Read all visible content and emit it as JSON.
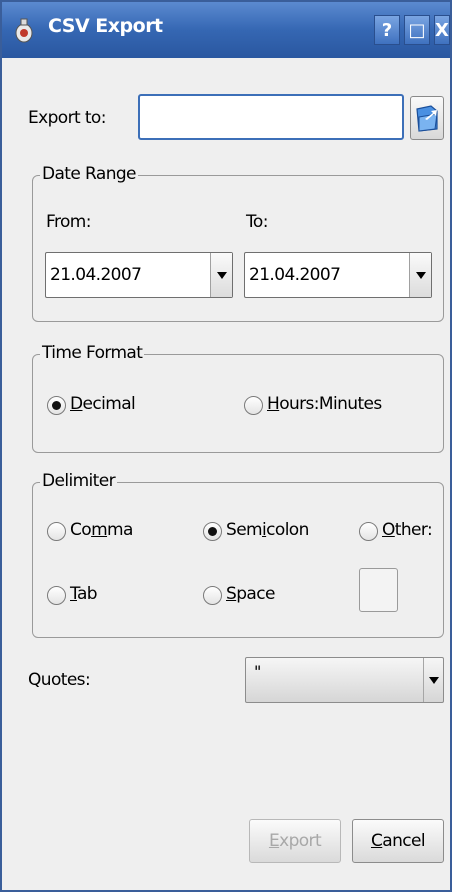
{
  "window": {
    "title": "CSV Export"
  },
  "titlebar": {
    "help": "?",
    "maximize": "□",
    "close": "X"
  },
  "export_to": {
    "label": "Export to:",
    "value": ""
  },
  "date_range": {
    "legend": "Date Range",
    "from_label": "From:",
    "to_label": "To:",
    "from_value": "21.04.2007",
    "to_value": "21.04.2007"
  },
  "time_format": {
    "legend": "Time Format",
    "options": [
      {
        "mnemonic": "D",
        "rest": "ecimal",
        "selected": true
      },
      {
        "mnemonic": "H",
        "rest": "ours:Minutes",
        "selected": false
      }
    ]
  },
  "delimiter": {
    "legend": "Delimiter",
    "comma": {
      "pre": "Co",
      "mnemonic": "m",
      "post": "ma",
      "selected": false
    },
    "semicolon": {
      "pre": "Sem",
      "mnemonic": "i",
      "post": "colon",
      "selected": true
    },
    "other": {
      "pre": "",
      "mnemonic": "O",
      "post": "ther:",
      "selected": false
    },
    "tab": {
      "pre": "",
      "mnemonic": "T",
      "post": "ab",
      "selected": false
    },
    "space": {
      "pre": "",
      "mnemonic": "S",
      "post": "pace",
      "selected": false
    },
    "other_value": ""
  },
  "quotes": {
    "label": "Quotes:",
    "value": "\""
  },
  "buttons": {
    "export": {
      "pre": "",
      "mnemonic": "E",
      "post": "xport",
      "enabled": false
    },
    "cancel": {
      "pre": "",
      "mnemonic": "C",
      "post": "ancel",
      "enabled": true
    }
  },
  "colors": {
    "titlebar": "#3567b3",
    "accent": "#3c6fb8",
    "window_bg": "#efefef"
  }
}
